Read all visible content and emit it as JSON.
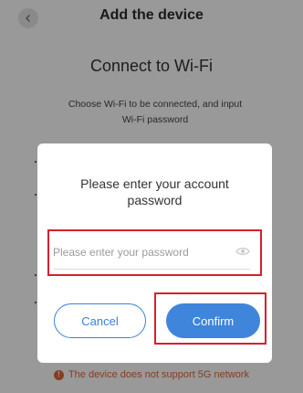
{
  "header": {
    "title": "Add the device",
    "back_icon": "chevron-left-icon"
  },
  "main": {
    "title": "Connect to Wi-Fi",
    "description": "Choose Wi-Fi to be connected, and input Wi-Fi password",
    "warning": "The device does not support 5G network",
    "warning_icon": "exclamation-circle-icon"
  },
  "dialog": {
    "title": "Please enter your account password",
    "password_value": "",
    "password_placeholder": "Please enter your password",
    "eye_icon": "eye-icon",
    "cancel_label": "Cancel",
    "confirm_label": "Confirm"
  },
  "colors": {
    "accent": "#3e85db",
    "highlight": "#d5202f",
    "warning": "#e0663a"
  }
}
